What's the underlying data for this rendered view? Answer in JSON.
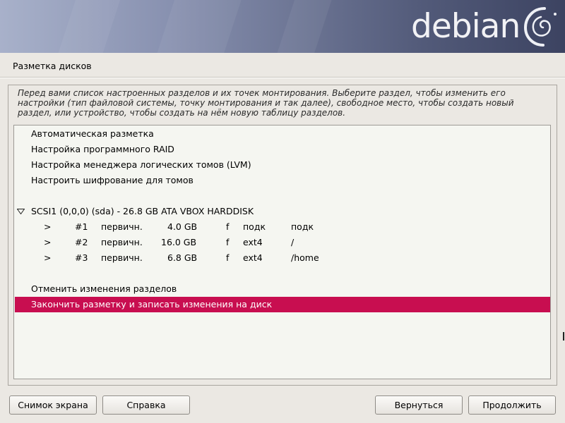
{
  "banner": {
    "logo_text": "debian",
    "colors": {
      "gradient_start": "#a8b1ca",
      "gradient_end": "#3c4361",
      "logo": "#f2f2f5"
    }
  },
  "page": {
    "title": "Разметка дисков",
    "description": [
      "Перед вами список настроенных разделов и их точек монтирования. Выберите раздел, чтобы изменить его",
      "настройки (тип файловой системы, точку монтирования и так далее), свободное место, чтобы создать новый",
      "раздел, или устройство, чтобы создать на нём новую таблицу разделов."
    ]
  },
  "menu": {
    "guided": "Автоматическая разметка",
    "raid": "Настройка программного RAID",
    "lvm": "Настройка менеджера логических томов (LVM)",
    "crypto": "Настроить шифрование для томов",
    "disk": "SCSI1 (0,0,0) (sda) - 26.8 GB ATA VBOX HARDDISK",
    "partitions": [
      {
        "arrow": ">",
        "num": "#1",
        "type": "первичн.",
        "size": "4.0 GB",
        "flag": "f",
        "fs": "подк",
        "mount": "подк"
      },
      {
        "arrow": ">",
        "num": "#2",
        "type": "первичн.",
        "size": "16.0 GB",
        "flag": "f",
        "fs": "ext4",
        "mount": "/"
      },
      {
        "arrow": ">",
        "num": "#3",
        "type": "первичн.",
        "size": "6.8 GB",
        "flag": "f",
        "fs": "ext4",
        "mount": "/home"
      }
    ],
    "undo": "Отменить изменения разделов",
    "finish": "Закончить разметку и записать изменения на диск",
    "selected_color": "#c80e50"
  },
  "buttons": {
    "screenshot": "Снимок экрана",
    "help": "Справка",
    "back": "Вернуться",
    "continue": "Продолжить"
  }
}
